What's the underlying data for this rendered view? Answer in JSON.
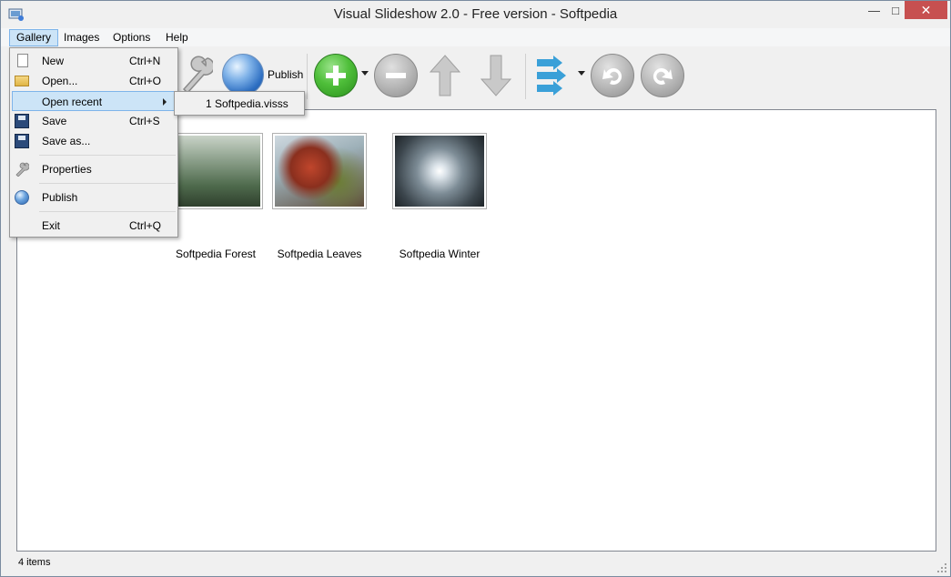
{
  "window": {
    "title": "Visual Slideshow 2.0 - Free version - Softpedia",
    "min_glyph": "—",
    "max_glyph": "□",
    "close_glyph": "✕"
  },
  "menubar": {
    "gallery": "Gallery",
    "images": "Images",
    "options": "Options",
    "help": "Help"
  },
  "toolbar": {
    "publish_label": "Publish"
  },
  "gallery_menu": {
    "new": {
      "label": "New",
      "shortcut": "Ctrl+N"
    },
    "open": {
      "label": "Open...",
      "shortcut": "Ctrl+O"
    },
    "open_recent": {
      "label": "Open recent"
    },
    "save": {
      "label": "Save",
      "shortcut": "Ctrl+S"
    },
    "save_as": {
      "label": "Save as..."
    },
    "properties": {
      "label": "Properties"
    },
    "publish": {
      "label": "Publish"
    },
    "exit": {
      "label": "Exit",
      "shortcut": "Ctrl+Q"
    }
  },
  "recent_submenu": {
    "item1": "1 Softpedia.visss"
  },
  "gallery": {
    "thumbnails": [
      {
        "label": "Softpedia Forest"
      },
      {
        "label": "Softpedia Leaves"
      },
      {
        "label": "Softpedia Winter"
      }
    ]
  },
  "statusbar": {
    "text": "4 items"
  },
  "colors": {
    "accent": "#cce4f7",
    "close_button": "#c75050",
    "add_green": "#4fbf3a"
  }
}
